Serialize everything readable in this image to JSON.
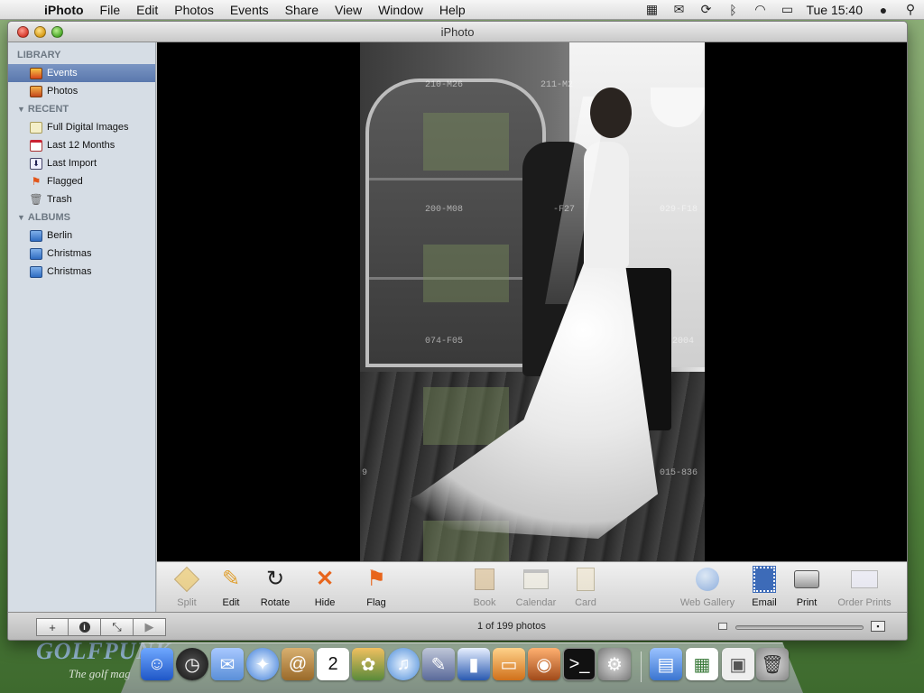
{
  "menubar": {
    "app_name": "iPhoto",
    "items": [
      "File",
      "Edit",
      "Photos",
      "Events",
      "Share",
      "View",
      "Window",
      "Help"
    ],
    "clock": "Tue 15:40"
  },
  "window": {
    "title": "iPhoto"
  },
  "sidebar": {
    "library_header": "LIBRARY",
    "library_items": [
      {
        "label": "Events",
        "icon": "events-icon",
        "selected": true
      },
      {
        "label": "Photos",
        "icon": "photos-icon",
        "selected": false
      }
    ],
    "recent_header": "RECENT",
    "recent_items": [
      {
        "label": "Full Digital Images",
        "icon": "full-images-icon"
      },
      {
        "label": "Last 12 Months",
        "icon": "calendar-icon"
      },
      {
        "label": "Last Import",
        "icon": "import-icon"
      },
      {
        "label": "Flagged",
        "icon": "flag-icon"
      },
      {
        "label": "Trash",
        "icon": "trash-icon"
      }
    ],
    "albums_header": "ALBUMS",
    "album_items": [
      {
        "label": "Berlin",
        "icon": "album-icon"
      },
      {
        "label": "Christmas",
        "icon": "album-icon"
      },
      {
        "label": "Christmas",
        "icon": "album-icon"
      }
    ]
  },
  "viewer": {
    "ghost_labels": [
      "210-M26",
      "211-M2",
      "200-M08",
      "-F27",
      "029-F18",
      "074-F05",
      "2004",
      "9",
      "015-836"
    ]
  },
  "toolbar": {
    "left_tools": [
      {
        "label": "Split",
        "icon": "split-icon",
        "enabled": false
      },
      {
        "label": "Edit",
        "icon": "pencil-icon",
        "enabled": true
      },
      {
        "label": "Rotate",
        "icon": "rotate-icon",
        "enabled": true
      },
      {
        "label": "Hide",
        "icon": "hide-x-icon",
        "enabled": true
      },
      {
        "label": "Flag",
        "icon": "flag-icon",
        "enabled": true
      }
    ],
    "middle_tools": [
      {
        "label": "Book",
        "icon": "book-icon",
        "enabled": false
      },
      {
        "label": "Calendar",
        "icon": "calendar-icon",
        "enabled": false
      },
      {
        "label": "Card",
        "icon": "card-icon",
        "enabled": false
      }
    ],
    "right_tools": [
      {
        "label": "Web Gallery",
        "icon": "globe-icon",
        "enabled": false
      },
      {
        "label": "Email",
        "icon": "email-stamp-icon",
        "enabled": true
      },
      {
        "label": "Print",
        "icon": "printer-icon",
        "enabled": true
      },
      {
        "label": "Order Prints",
        "icon": "order-prints-icon",
        "enabled": false
      }
    ]
  },
  "bottombar": {
    "status": "1 of 199 photos"
  },
  "desktop": {
    "logo": "GOLFPUNK",
    "tagline": "The golf mag"
  },
  "colors": {
    "selection": "#5a78ad",
    "sidebar_bg": "#d6dde5",
    "viewer_bg": "#000000"
  }
}
